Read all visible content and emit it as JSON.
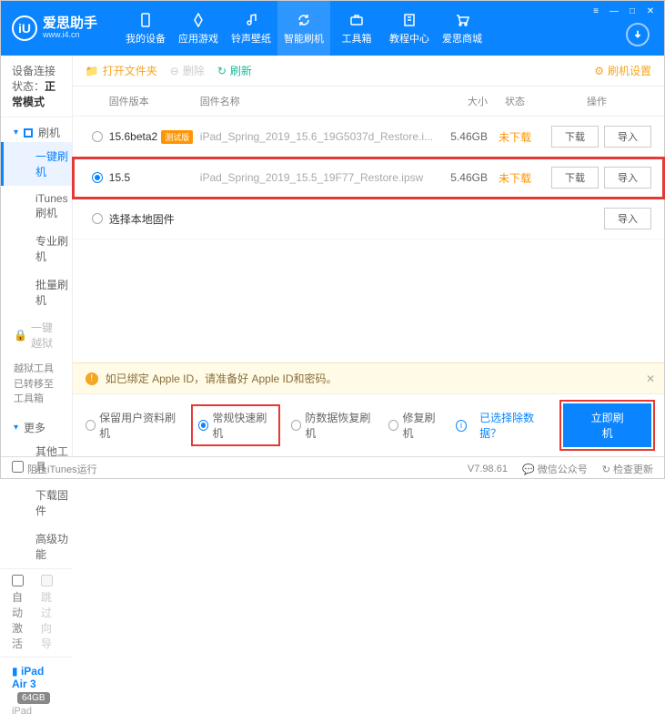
{
  "brand": {
    "cn": "爱思助手",
    "url": "www.i4.cn",
    "logo_letter": "iU"
  },
  "window_controls": {
    "menu": "≡",
    "min": "—",
    "max": "□",
    "close": "✕"
  },
  "nav": [
    {
      "label": "我的设备"
    },
    {
      "label": "应用游戏"
    },
    {
      "label": "铃声壁纸"
    },
    {
      "label": "智能刷机"
    },
    {
      "label": "工具箱"
    },
    {
      "label": "教程中心"
    },
    {
      "label": "爱思商城"
    }
  ],
  "conn_status": {
    "label": "设备连接状态：",
    "value": "正常模式"
  },
  "sidebar": {
    "flash": {
      "title": "刷机",
      "items": [
        "一键刷机",
        "iTunes刷机",
        "专业刷机",
        "批量刷机"
      ]
    },
    "jailbreak": {
      "title": "一键越狱",
      "note": "越狱工具已转移至工具箱"
    },
    "more": {
      "title": "更多",
      "items": [
        "其他工具",
        "下载固件",
        "高级功能"
      ]
    },
    "auto_activate": "自动激活",
    "skip_guide": "跳过向导"
  },
  "device": {
    "name": "iPad Air 3",
    "storage": "64GB",
    "type": "iPad"
  },
  "toolbar": {
    "open": "打开文件夹",
    "delete": "删除",
    "refresh": "刷新",
    "settings": "刷机设置"
  },
  "columns": {
    "ver": "固件版本",
    "name": "固件名称",
    "size": "大小",
    "state": "状态",
    "ops": "操作"
  },
  "rows": [
    {
      "selected": false,
      "ver": "15.6beta2",
      "tag": "测试版",
      "name": "iPad_Spring_2019_15.6_19G5037d_Restore.i...",
      "size": "5.46GB",
      "state": "未下载"
    },
    {
      "selected": true,
      "ver": "15.5",
      "tag": "",
      "name": "iPad_Spring_2019_15.5_19F77_Restore.ipsw",
      "size": "5.46GB",
      "state": "未下载"
    }
  ],
  "local_fw": "选择本地固件",
  "btns": {
    "download": "下载",
    "import": "导入"
  },
  "warning": "如已绑定 Apple ID，请准备好 Apple ID和密码。",
  "options": {
    "keep": "保留用户资料刷机",
    "normal": "常规快速刷机",
    "antirec": "防数据恢复刷机",
    "repair": "修复刷机",
    "exclude": "已选择除数据？"
  },
  "primary": "立即刷机",
  "footer": {
    "block": "阻止iTunes运行",
    "ver": "V7.98.61",
    "wechat": "微信公众号",
    "check": "检查更新"
  }
}
